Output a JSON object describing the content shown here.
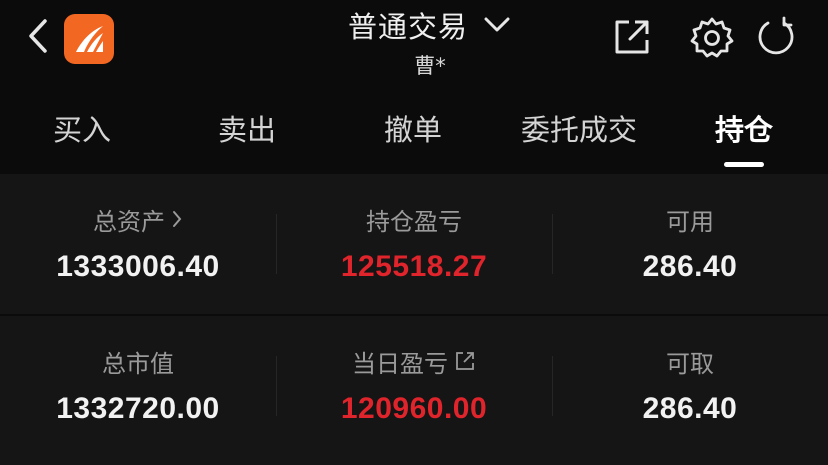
{
  "header": {
    "title": "普通交易",
    "account": "曹*",
    "icons": {
      "back": "chevron-left-icon",
      "logo": "broker-logo",
      "dropdown": "chevron-down-icon",
      "share": "share-external-icon",
      "settings": "gear-icon",
      "refresh": "refresh-icon"
    },
    "logo_color": "#f26722"
  },
  "tabs": [
    {
      "label": "买入",
      "active": false
    },
    {
      "label": "卖出",
      "active": false
    },
    {
      "label": "撤单",
      "active": false
    },
    {
      "label": "委托成交",
      "active": false
    },
    {
      "label": "持仓",
      "active": true
    }
  ],
  "summary": {
    "row1": [
      {
        "label": "总资产",
        "value": "1333006.40",
        "suffix_icon": "chevron-right-icon"
      },
      {
        "label": "持仓盈亏",
        "value": "125518.27",
        "color": "#e0242c"
      },
      {
        "label": "可用",
        "value": "286.40"
      }
    ],
    "row2": [
      {
        "label": "总市值",
        "value": "1332720.00"
      },
      {
        "label": "当日盈亏",
        "value": "120960.00",
        "color": "#e0242c",
        "suffix_icon": "open-external-icon"
      },
      {
        "label": "可取",
        "value": "286.40"
      }
    ]
  },
  "colors": {
    "background": "#0b0b0b",
    "panel": "#151515",
    "profit_red": "#e0242c",
    "label_gray": "#9a9a9a"
  }
}
